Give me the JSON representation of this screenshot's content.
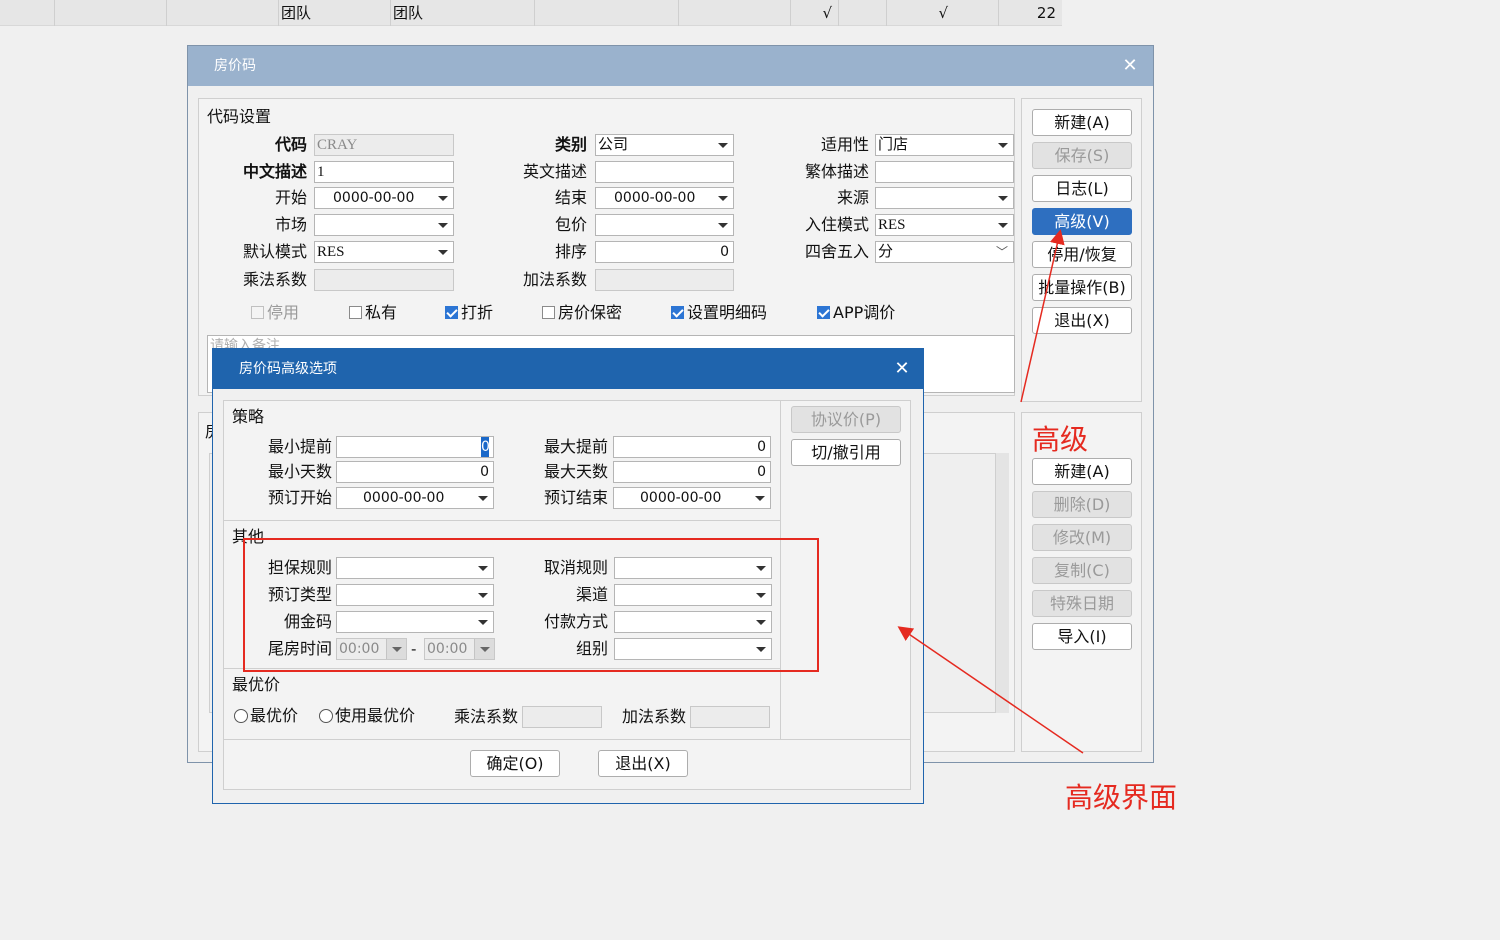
{
  "topstrip": {
    "c1": "团队",
    "c2": "团队",
    "c3": "√",
    "c4": "√",
    "c5": "22"
  },
  "main_dialog": {
    "title": "房价码",
    "section": "代码设置",
    "col1": {
      "code_label": "代码",
      "code_value": "CRAY",
      "cn_desc_label": "中文描述",
      "cn_desc_value": "1",
      "start_label": "开始",
      "start_value": "0000-00-00",
      "market_label": "市场",
      "market_value": "",
      "default_mode_label": "默认模式",
      "default_mode_value": "RES",
      "mult_label": "乘法系数",
      "mult_value": ""
    },
    "col2": {
      "category_label": "类别",
      "category_value": "公司",
      "en_desc_label": "英文描述",
      "en_desc_value": "",
      "end_label": "结束",
      "end_value": "0000-00-00",
      "package_label": "包价",
      "package_value": "",
      "sort_label": "排序",
      "sort_value": "0",
      "add_label": "加法系数",
      "add_value": ""
    },
    "col3": {
      "applicability_label": "适用性",
      "applicability_value": "门店",
      "tc_desc_label": "繁体描述",
      "tc_desc_value": "",
      "source_label": "来源",
      "source_value": "",
      "checkin_mode_label": "入住模式",
      "checkin_mode_value": "RES",
      "rounding_label": "四舍五入",
      "rounding_value": "分"
    },
    "checkboxes": {
      "disabled": "停用",
      "private": "私有",
      "discount": "打折",
      "rate_secret": "房价保密",
      "detail_code": "设置明细码",
      "app_adjust": "APP调价"
    },
    "remark_placeholder": "请输入备注",
    "section2_partial": "房",
    "buttons_top": {
      "new": "新建(A)",
      "save": "保存(S)",
      "log": "日志(L)",
      "advanced": "高级(V)",
      "toggle": "停用/恢复",
      "batch": "批量操作(B)",
      "exit": "退出(X)"
    },
    "buttons_bottom": {
      "new": "新建(A)",
      "delete": "删除(D)",
      "modify": "修改(M)",
      "copy": "复制(C)",
      "special_date": "特殊日期",
      "import": "导入(I)"
    }
  },
  "adv_dialog": {
    "title": "房价码高级选项",
    "strategy": {
      "title": "策略",
      "min_advance_label": "最小提前",
      "min_advance_value": "0",
      "max_advance_label": "最大提前",
      "max_advance_value": "0",
      "min_days_label": "最小天数",
      "min_days_value": "0",
      "max_days_label": "最大天数",
      "max_days_value": "0",
      "book_start_label": "预订开始",
      "book_start_value": "0000-00-00",
      "book_end_label": "预订结束",
      "book_end_value": "0000-00-00"
    },
    "other": {
      "title": "其他",
      "guarantee_label": "担保规则",
      "guarantee_value": "",
      "cancel_label": "取消规则",
      "cancel_value": "",
      "booking_type_label": "预订类型",
      "booking_type_value": "",
      "channel_label": "渠道",
      "channel_value": "",
      "commission_label": "佣金码",
      "commission_value": "",
      "payment_label": "付款方式",
      "payment_value": "",
      "tail_time_label": "尾房时间",
      "tail_from": "00:00",
      "tail_sep": "-",
      "tail_to": "00:00",
      "group_label": "组别",
      "group_value": ""
    },
    "best": {
      "title": "最优价",
      "radio_best": "最优价",
      "radio_use_best": "使用最优价",
      "mult_label": "乘法系数",
      "mult_value": "",
      "add_label": "加法系数",
      "add_value": ""
    },
    "side_buttons": {
      "agreement": "协议价(P)",
      "toggle_ref": "切/撤引用"
    },
    "ok": "确定(O)",
    "exit": "退出(X)"
  },
  "annotations": {
    "advanced": "高级",
    "advanced_ui": "高级界面",
    "color": "#e52a20"
  }
}
